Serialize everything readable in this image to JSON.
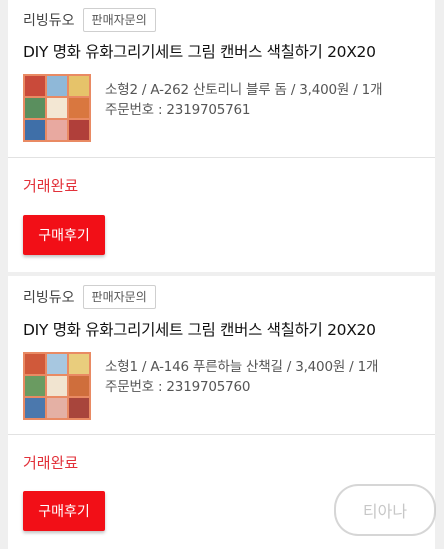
{
  "orders": [
    {
      "seller": "리빙듀오",
      "inquiry_label": "판매자문의",
      "title": "DIY 명화 유화그리기세트 그림 캔버스 색칠하기 20X20",
      "option": "소형2 / A-262 산토리니 블루 돔 / 3,400원 / 1개",
      "order_number": "주문번호 : 2319705761",
      "status": "거래완료",
      "review_label": "구매후기"
    },
    {
      "seller": "리빙듀오",
      "inquiry_label": "판매자문의",
      "title": "DIY 명화 유화그리기세트 그림 캔버스 색칠하기 20X20",
      "option": "소형1 / A-146 푸른하늘 산책길 / 3,400원 / 1개",
      "order_number": "주문번호 : 2319705760",
      "status": "거래완료",
      "review_label": "구매후기"
    }
  ],
  "watermark": "티아나",
  "colors": {
    "accent": "#f20f17",
    "status": "#e2313a",
    "background": "#efefef"
  }
}
